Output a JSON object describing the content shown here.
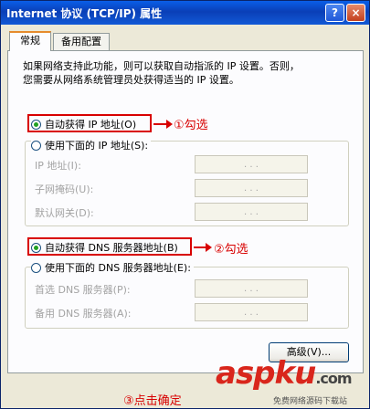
{
  "window": {
    "title": "Internet 协议 (TCP/IP) 属性",
    "help_label": "?",
    "close_label": "×"
  },
  "tabs": [
    {
      "label": "常规",
      "active": true
    },
    {
      "label": "备用配置",
      "active": false
    }
  ],
  "intro_text": "如果网络支持此功能，则可以获取自动指派的 IP 设置。否则，\n您需要从网络系统管理员处获得适当的 IP 设置。",
  "ip_section": {
    "auto_radio": {
      "label": "自动获得 IP 地址(O)",
      "checked": true
    },
    "manual_radio": {
      "label": "使用下面的 IP 地址(S):",
      "checked": false
    },
    "fields": [
      {
        "label": "IP 地址(I):"
      },
      {
        "label": "子网掩码(U):"
      },
      {
        "label": "默认网关(D):"
      }
    ]
  },
  "dns_section": {
    "auto_radio": {
      "label": "自动获得 DNS 服务器地址(B)",
      "checked": true
    },
    "manual_radio": {
      "label": "使用下面的 DNS 服务器地址(E):",
      "checked": false
    },
    "fields": [
      {
        "label": "首选 DNS 服务器(P):"
      },
      {
        "label": "备用 DNS 服务器(A):"
      }
    ]
  },
  "ip_dots": ".   .   .",
  "advanced_button": "高级(V)...",
  "annotations": {
    "step1": "①勾选",
    "step2": "②勾选",
    "step3": "③点击确定"
  },
  "watermark": {
    "brand": "aspku",
    "brand_suffix": ".com",
    "tagline": "免费网络源码下载站"
  },
  "colors": {
    "highlight": "#d80000",
    "titlebar": "#0a5ee8",
    "dialog_bg": "#ece9d8"
  }
}
